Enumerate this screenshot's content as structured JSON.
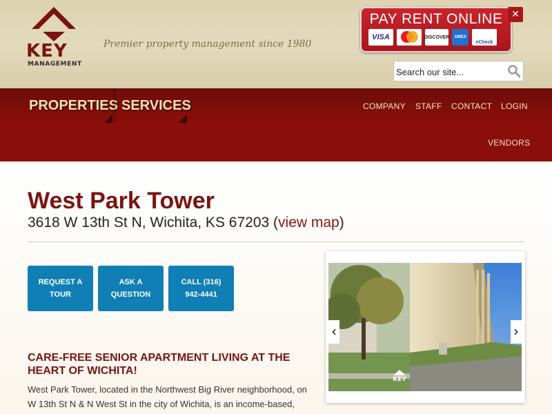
{
  "header": {
    "logo_text": "KEY",
    "logo_subtext": "MANAGEMENT",
    "tagline": "Premier property management since 1980",
    "pay_rent_label": "PAY RENT ONLINE",
    "payment_cards": [
      "VISA",
      "MasterCard",
      "DISCOVER",
      "AMEX",
      "eCheck"
    ],
    "search_placeholder": "Search our site..."
  },
  "nav": {
    "main": [
      "PROPERTIES",
      "SERVICES"
    ],
    "secondary": [
      "COMPANY",
      "STAFF",
      "CONTACT",
      "LOGIN",
      "VENDORS"
    ]
  },
  "property": {
    "name": "West Park Tower",
    "address": "3618 W 13th St N, Wichita, KS 67203",
    "map_link_label": "view map",
    "buttons": [
      "REQUEST A TOUR",
      "ASK A QUESTION",
      "CALL (316) 942-4441"
    ],
    "section_heading": "CARE-FREE SENIOR APARTMENT LIVING AT THE HEART OF WICHITA!",
    "description": "West Park Tower, located in the Northwest Big River neighborhood, on W 13th St N & N West St in the city of Wichita, is an income-based,"
  },
  "slider": {
    "watermark": "KEY",
    "prev_label": "‹",
    "next_label": "›"
  },
  "colors": {
    "brand_red": "#7a1410",
    "nav_red": "#8a0e0a",
    "cta_blue": "#0f7fb5",
    "nav_text": "#f3e3b3"
  }
}
